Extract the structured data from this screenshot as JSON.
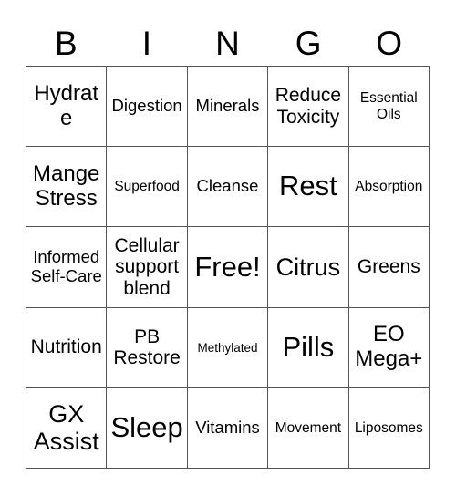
{
  "card": {
    "header_letters": [
      "B",
      "I",
      "N",
      "G",
      "O"
    ],
    "rows": [
      [
        {
          "label": "Hydrate",
          "size": "lg"
        },
        {
          "label": "Digestion",
          "size": "sm"
        },
        {
          "label": "Minerals",
          "size": "sm"
        },
        {
          "label": "Reduce Toxicity",
          "size": "md"
        },
        {
          "label": "Essential Oils",
          "size": "xs"
        }
      ],
      [
        {
          "label": "Mange Stress",
          "size": "lg"
        },
        {
          "label": "Superfood",
          "size": "xs"
        },
        {
          "label": "Cleanse",
          "size": "sm"
        },
        {
          "label": "Rest",
          "size": "xxl"
        },
        {
          "label": "Absorption",
          "size": "xs"
        }
      ],
      [
        {
          "label": "Informed Self-Care",
          "size": "sm"
        },
        {
          "label": "Cellular support blend",
          "size": "md"
        },
        {
          "label": "Free!",
          "size": "xxl"
        },
        {
          "label": "Citrus",
          "size": "xl"
        },
        {
          "label": "Greens",
          "size": "md"
        }
      ],
      [
        {
          "label": "Nutrition",
          "size": "md"
        },
        {
          "label": "PB Restore",
          "size": "md"
        },
        {
          "label": "Methylated",
          "size": "xxs"
        },
        {
          "label": "Pills",
          "size": "xxl"
        },
        {
          "label": "EO Mega+",
          "size": "lg"
        }
      ],
      [
        {
          "label": "GX Assist",
          "size": "xl"
        },
        {
          "label": "Sleep",
          "size": "xxl"
        },
        {
          "label": "Vitamins",
          "size": "sm"
        },
        {
          "label": "Movement",
          "size": "xs"
        },
        {
          "label": "Liposomes",
          "size": "xs"
        }
      ]
    ],
    "free_space": {
      "row": 2,
      "col": 2,
      "label": "Free!"
    },
    "colors": {
      "background": "#ffffff",
      "text": "#000000",
      "grid_line": "#555555"
    }
  }
}
